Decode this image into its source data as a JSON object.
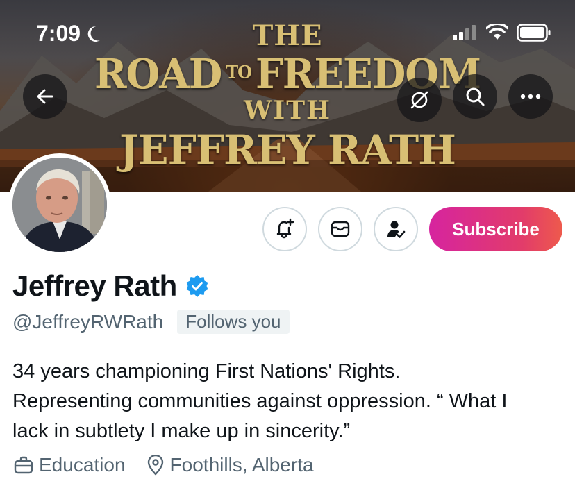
{
  "status_bar": {
    "time": "7:09"
  },
  "banner": {
    "line1": "THE",
    "line2a": "ROAD",
    "line2b": "TO",
    "line2c": "FREEDOM",
    "line3": "WITH",
    "line4": "JEFFREY RATH"
  },
  "actions": {
    "subscribe_label": "Subscribe"
  },
  "profile": {
    "display_name": "Jeffrey Rath",
    "handle": "@JeffreyRWRath",
    "follows_you": "Follows you",
    "bio_line1": "34 years championing First Nations' Rights.",
    "bio_line2": "Representing communities against oppression. “ What I",
    "bio_line3": "lack in subtlety I make up in sincerity.”",
    "category": "Education",
    "location": "Foothills, Alberta"
  },
  "colors": {
    "verified_blue": "#1d9bf0",
    "subscribe_start": "#d6249f",
    "subscribe_end": "#ee5a4c",
    "secondary_text": "#536471"
  },
  "icons": {
    "back": "arrow-left-icon",
    "grok": "grok-icon",
    "search": "search-icon",
    "more": "more-icon",
    "notify": "bell-plus-icon",
    "message": "envelope-icon",
    "follow": "person-check-icon",
    "verified": "verified-badge-icon",
    "category": "briefcase-icon",
    "location": "location-pin-icon"
  }
}
